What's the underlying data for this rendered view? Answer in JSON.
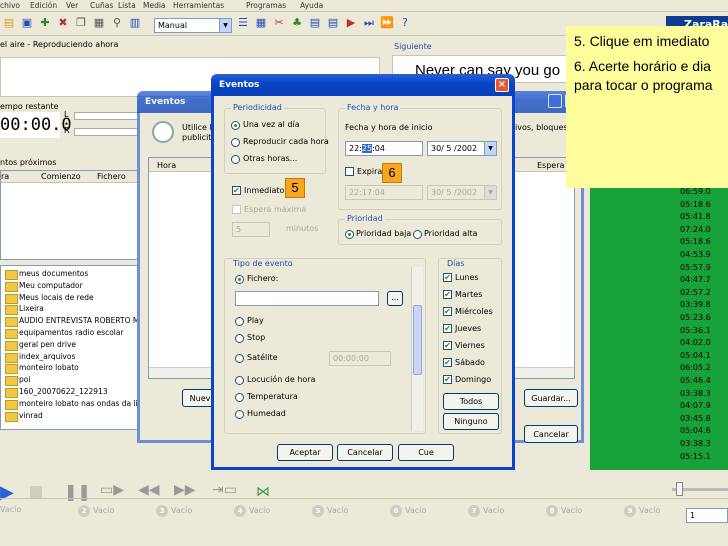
{
  "menu": {
    "items": [
      "chivo",
      "Edición",
      "Ver",
      "Cuñas",
      "Lista",
      "Media",
      "Herramientas",
      "Programas",
      "Ayuda"
    ]
  },
  "toolbar": {
    "mode": "Manual",
    "logo": "ZaraRa"
  },
  "onair": {
    "title": "el aire - Reproduciendo ahora",
    "remaining_label": "empo restante",
    "time": "00:00.0",
    "L": "L",
    "R": "R",
    "upcoming": "ntos próximos",
    "col1": "ra",
    "col2": "Comienzo",
    "col3": "Fichero"
  },
  "next": {
    "title": "Siguiente",
    "song": "Never can say you go"
  },
  "files": [
    "meus documentos",
    "Meu computador",
    "Meus locais de rede",
    "Lixeira",
    "AUDIO ENTREVISTA ROBERTO M",
    "equipamentos radio escolar",
    "geral pen drive",
    "index_arquivos",
    "monteiro lobato",
    "poi",
    "160_20070622_122913",
    "monteiro lobato nas ondas da lit",
    "vinrad"
  ],
  "background_dialog": {
    "title": "Eventos",
    "text1": "Utilice lo",
    "text2": "publicita",
    "right_text": "ivos, bloques",
    "col_hora": "Hora",
    "col_espera": "Espera ...",
    "btn_new": "Nuev",
    "btn_save": "Guardar...",
    "btn_cancel": "Cancelar"
  },
  "dialog": {
    "title": "Eventos",
    "close": "×",
    "periodicidad": {
      "title": "Periodicidad",
      "opt1": "Una vez al día",
      "opt2": "Reproducir cada hora",
      "opt3": "Otras horas..."
    },
    "immediate": {
      "label": "Inmediato",
      "wait": "Espera máxima",
      "minutes_value": "5",
      "minutes": "minutos"
    },
    "fecha": {
      "title": "Fecha y hora",
      "start_label": "Fecha y hora de inicio",
      "time_a": "22:",
      "time_sel": "25",
      "time_b": ":04",
      "date": "30/ 5 /2002",
      "expire_label": "Expiració",
      "exp_time": "22:17:04",
      "exp_date": "30/ 5 /2002"
    },
    "prioridad": {
      "title": "Prioridad",
      "low": "Prioridad baja",
      "high": "Prioridad alta"
    },
    "tipo": {
      "title": "Tipo de evento",
      "fichero": "Fichero:",
      "browse": "...",
      "play": "Play",
      "stop": "Stop",
      "satelite": "Satélite",
      "sat_time": "00:00:00",
      "locucion": "Locución de hora",
      "temperatura": "Temperatura",
      "humedad": "Humedad"
    },
    "dias": {
      "title": "Días",
      "days": [
        "Lunes",
        "Martes",
        "Miércoles",
        "Jueves",
        "Viernes",
        "Sábado",
        "Domingo"
      ],
      "todos": "Todos",
      "ninguno": "Ninguno"
    },
    "buttons": {
      "accept": "Aceptar",
      "cancel": "Cancelar",
      "ok": "Cue"
    }
  },
  "annotations": {
    "marker5": "5",
    "marker6": "6",
    "note1": "5. Clique em imediato",
    "note2": "6. Acerte horário e dia para tocar o programa"
  },
  "green_times": [
    "06:59.0",
    "05:18.6",
    "05:41.8",
    "07:24.0",
    "05:18.6",
    "04:53.9",
    "05:57.9",
    "04:47.7",
    "02:57.2",
    "03:39.8",
    "05:23.6",
    "05:36.1",
    "04:02.0",
    "05:04.1",
    "06:05.2",
    "05:46.4",
    "03:38.3",
    "04:07.9",
    "03:45.8",
    "05:04.6",
    "03:38.3",
    "05:15.1"
  ],
  "bottom": {
    "slots": [
      "Vacío",
      "Vacío",
      "Vacío",
      "Vacío",
      "Vacío",
      "Vacío",
      "Vacío",
      "Vacío",
      "Vacío"
    ],
    "counter": "1",
    "slot_nums": [
      "",
      "2",
      "3",
      "4",
      "5",
      "6",
      "7",
      "8",
      "9"
    ]
  },
  "colors": {
    "accent_blue": "#0a46c9",
    "green": "#17a23a",
    "note_yellow": "#fdfd9c",
    "marker_orange": "#f5a623"
  }
}
